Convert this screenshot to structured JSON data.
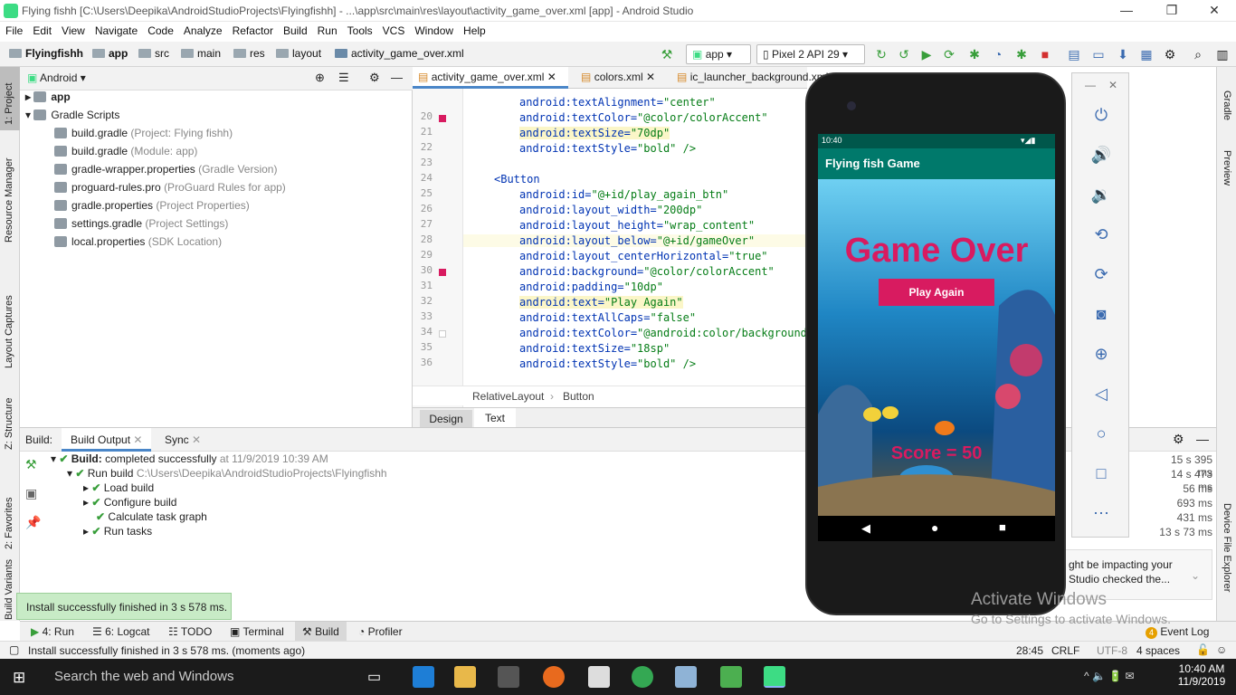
{
  "title_bar": {
    "text": "Flying fishh [C:\\Users\\Deepika\\AndroidStudioProjects\\Flyingfishh] - ...\\app\\src\\main\\res\\layout\\activity_game_over.xml [app] - Android Studio"
  },
  "menu": [
    "File",
    "Edit",
    "View",
    "Navigate",
    "Code",
    "Analyze",
    "Refactor",
    "Build",
    "Run",
    "Tools",
    "VCS",
    "Window",
    "Help"
  ],
  "breadcrumbs": [
    "Flyingfishh",
    "app",
    "src",
    "main",
    "res",
    "layout",
    "activity_game_over.xml"
  ],
  "run_config": "app",
  "device": "Pixel 2 API 29",
  "project": {
    "view": "Android",
    "items": [
      {
        "name": "app",
        "note": ""
      },
      {
        "name": "Gradle Scripts",
        "note": ""
      },
      {
        "name": "build.gradle",
        "note": "(Project: Flying fishh)"
      },
      {
        "name": "build.gradle",
        "note": "(Module: app)"
      },
      {
        "name": "gradle-wrapper.properties",
        "note": "(Gradle Version)"
      },
      {
        "name": "proguard-rules.pro",
        "note": "(ProGuard Rules for app)"
      },
      {
        "name": "gradle.properties",
        "note": "(Project Properties)"
      },
      {
        "name": "settings.gradle",
        "note": "(Project Settings)"
      },
      {
        "name": "local.properties",
        "note": "(SDK Location)"
      }
    ]
  },
  "left_tabs": [
    "1: Project",
    "Resource Manager",
    "Layout Captures",
    "Z: Structure",
    "2: Favorites",
    "Build Variants"
  ],
  "right_tabs": [
    "Gradle",
    "Preview",
    "Device File Explorer"
  ],
  "editor_tabs": [
    "activity_game_over.xml",
    "colors.xml",
    "ic_launcher_background.xml"
  ],
  "code_lines": [
    {
      "n": "20",
      "a": "android:textColor=",
      "v": "\"@color/colorAccent\"",
      "hl": false
    },
    {
      "n": "21",
      "a": "android:textSize=",
      "v": "\"70dp\"",
      "hl": true
    },
    {
      "n": "22",
      "a": "android:textStyle=",
      "v": "\"bold\" />",
      "hl": false
    },
    {
      "n": "23",
      "a": "",
      "v": "",
      "hl": false
    },
    {
      "n": "24",
      "a": "<Button",
      "v": "",
      "hl": false
    },
    {
      "n": "25",
      "a": "android:id=",
      "v": "\"@+id/play_again_btn\"",
      "hl": false
    },
    {
      "n": "26",
      "a": "android:layout_width=",
      "v": "\"200dp\"",
      "hl": false
    },
    {
      "n": "27",
      "a": "android:layout_height=",
      "v": "\"wrap_content\"",
      "hl": false
    },
    {
      "n": "28",
      "a": "android:layout_below=",
      "v": "\"@+id/gameOver\"",
      "hl": false
    },
    {
      "n": "29",
      "a": "android:layout_centerHorizontal=",
      "v": "\"true\"",
      "hl": false
    },
    {
      "n": "30",
      "a": "android:background=",
      "v": "\"@color/colorAccent\"",
      "hl": false
    },
    {
      "n": "31",
      "a": "android:padding=",
      "v": "\"10dp\"",
      "hl": false
    },
    {
      "n": "32",
      "a": "android:text=",
      "v": "\"Play Again\"",
      "hl": true
    },
    {
      "n": "33",
      "a": "android:textAllCaps=",
      "v": "\"false\"",
      "hl": false
    },
    {
      "n": "34",
      "a": "android:textColor=",
      "v": "\"@android:color/background_",
      "hl": false
    },
    {
      "n": "35",
      "a": "android:textSize=",
      "v": "\"18sp\"",
      "hl": false
    },
    {
      "n": "36",
      "a": "android:textStyle=",
      "v": "\"bold\" />",
      "hl": false
    }
  ],
  "code_top_line": {
    "n": "19",
    "a": "android:textAlignment=",
    "v": "\"center\""
  },
  "editor_breadcrumb": [
    "RelativeLayout",
    "Button"
  ],
  "design_tabs": [
    "Design",
    "Text"
  ],
  "build": {
    "label": "Build:",
    "tabs": [
      "Build Output",
      "Sync"
    ],
    "status_bold": "Build:",
    "status": "completed successfully",
    "status_time": "at 11/9/2019 10:39 AM",
    "run_build": "Run build",
    "run_path": "C:\\Users\\Deepika\\AndroidStudioProjects\\Flyingfishh",
    "tasks": [
      "Load build",
      "Configure build",
      "Calculate task graph",
      "Run tasks"
    ],
    "times": [
      "15 s 395 ms",
      "14 s 473 ms",
      "56 ms",
      "693 ms",
      "431 ms",
      "13 s 73 ms"
    ]
  },
  "notification": "ght be impacting your\nStudio checked the...",
  "toast": "Install successfully finished in 3 s 578 ms.",
  "bottom_tabs": [
    "4: Run",
    "6: Logcat",
    "TODO",
    "Terminal",
    "Build",
    "Profiler"
  ],
  "event_log": "Event Log",
  "event_count": "4",
  "status": {
    "message": "Install successfully finished in 3 s 578 ms. (moments ago)",
    "pos": "28:45",
    "crlf": "CRLF",
    "enc": "UTF-8",
    "indent": "4 spaces"
  },
  "activate": {
    "line1": "Activate Windows",
    "line2": "Go to Settings to activate Windows."
  },
  "taskbar": {
    "search": "Search the web and Windows",
    "time": "10:40 AM",
    "date": "11/9/2019"
  },
  "phone": {
    "time": "10:40",
    "app_title": "Flying fish Game",
    "game_over": "Game Over",
    "button": "Play Again",
    "score": "Score = 50"
  }
}
